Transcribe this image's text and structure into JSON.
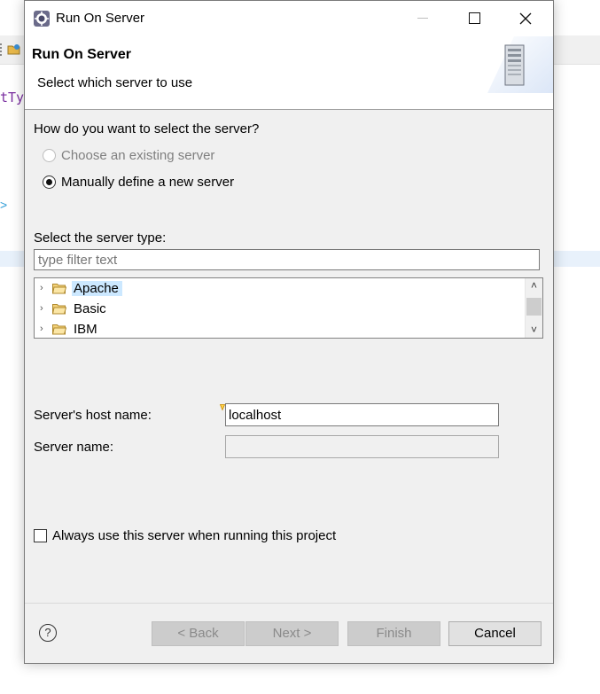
{
  "background": {
    "code_fragment": "tTyp",
    "arrow_glyph": ">"
  },
  "dialog": {
    "window_title": "Run On Server",
    "header_title": "Run On Server",
    "header_subtitle": "Select which server to use",
    "question": "How do you want to select the server?",
    "options": [
      {
        "label": "Choose an existing server",
        "selected": false,
        "enabled": false
      },
      {
        "label": "Manually define a new server",
        "selected": true,
        "enabled": true
      }
    ],
    "server_type_label": "Select the server type:",
    "filter_placeholder": "type filter text",
    "server_types": [
      {
        "label": "Apache",
        "selected": true
      },
      {
        "label": "Basic",
        "selected": false
      },
      {
        "label": "IBM",
        "selected": false
      }
    ],
    "host_label": "Server's host name:",
    "host_value": "localhost",
    "name_label": "Server name:",
    "name_value": "",
    "always_use_label": "Always use this server when running this project",
    "always_use_checked": false,
    "help_symbol": "?",
    "buttons": {
      "back": "< Back",
      "next": "Next >",
      "finish": "Finish",
      "cancel": "Cancel"
    }
  },
  "colors": {
    "selection": "#cce8ff",
    "folder": "#e8b84a",
    "dialog_bg": "#f0f0f0"
  },
  "icons": [
    "eclipse-app-icon",
    "minimize-icon",
    "maximize-icon",
    "close-icon",
    "server-icon",
    "folder-icon",
    "chevron-right-icon",
    "scroll-up-icon",
    "scroll-down-icon",
    "help-icon"
  ]
}
